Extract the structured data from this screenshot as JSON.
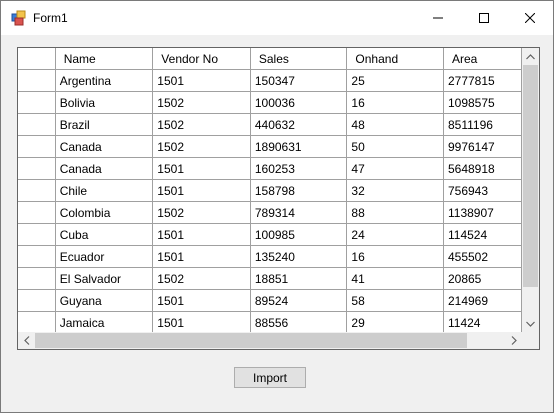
{
  "window": {
    "title": "Form1"
  },
  "grid": {
    "columns": [
      "Name",
      "Vendor No",
      "Sales",
      "Onhand",
      "Area"
    ],
    "rows": [
      [
        "Argentina",
        "1501",
        "150347",
        "25",
        "2777815"
      ],
      [
        "Bolivia",
        "1502",
        "100036",
        "16",
        "1098575"
      ],
      [
        "Brazil",
        "1502",
        "440632",
        "48",
        "8511196"
      ],
      [
        "Canada",
        "1502",
        "1890631",
        "50",
        "9976147"
      ],
      [
        "Canada",
        "1501",
        "160253",
        "47",
        "5648918"
      ],
      [
        "Chile",
        "1501",
        "158798",
        "32",
        "756943"
      ],
      [
        "Colombia",
        "1502",
        "789314",
        "88",
        "1138907"
      ],
      [
        "Cuba",
        "1501",
        "100985",
        "24",
        "114524"
      ],
      [
        "Ecuador",
        "1501",
        "135240",
        "16",
        "455502"
      ],
      [
        "El Salvador",
        "1502",
        "18851",
        "41",
        "20865"
      ],
      [
        "Guyana",
        "1501",
        "89524",
        "58",
        "214969"
      ],
      [
        "Jamaica",
        "1501",
        "88556",
        "29",
        "11424"
      ]
    ]
  },
  "actions": {
    "import_label": "Import"
  },
  "colors": {
    "window_bg": "#f0f0f0",
    "grid_line": "#a0a0a0",
    "scroll_thumb": "#cdcdcd"
  }
}
